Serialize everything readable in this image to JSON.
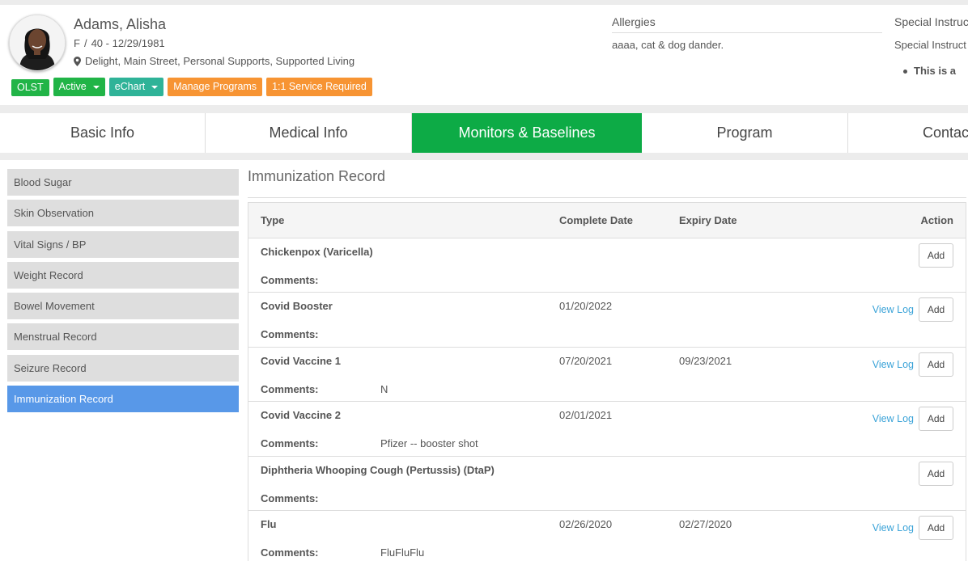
{
  "patient": {
    "name": "Adams, Alisha",
    "gender": "F",
    "age_dob": "40 - 12/29/1981",
    "address": "Delight, Main Street, Personal Supports, Supported Living"
  },
  "badges": {
    "olst": "OLST",
    "active": "Active",
    "echart": "eChart",
    "manage_programs": "Manage Programs",
    "service_required": "1:1 Service Required"
  },
  "allergies": {
    "title": "Allergies",
    "text": "aaaa, cat & dog dander."
  },
  "special": {
    "title": "Special Instruc",
    "subtitle": "Special Instruct",
    "bullet": "This is a"
  },
  "tabs": [
    {
      "label": "Basic Info"
    },
    {
      "label": "Medical Info"
    },
    {
      "label": "Monitors & Baselines"
    },
    {
      "label": "Program"
    },
    {
      "label": "Contac"
    }
  ],
  "sidebar": {
    "items": [
      {
        "label": "Blood Sugar"
      },
      {
        "label": "Skin Observation"
      },
      {
        "label": "Vital Signs / BP"
      },
      {
        "label": "Weight Record"
      },
      {
        "label": "Bowel Movement"
      },
      {
        "label": "Menstrual Record"
      },
      {
        "label": "Seizure Record"
      },
      {
        "label": "Immunization Record"
      }
    ]
  },
  "main": {
    "title": "Immunization Record",
    "headers": {
      "type": "Type",
      "complete_date": "Complete Date",
      "expiry_date": "Expiry Date",
      "action": "Action"
    },
    "comments_label": "Comments:",
    "view_log_label": "View Log",
    "add_label": "Add",
    "rows": [
      {
        "type": "Chickenpox (Varicella)",
        "complete_date": "",
        "expiry_date": "",
        "comment": ""
      },
      {
        "type": "Covid Booster",
        "complete_date": "01/20/2022",
        "expiry_date": "",
        "comment": ""
      },
      {
        "type": "Covid Vaccine 1",
        "complete_date": "07/20/2021",
        "expiry_date": "09/23/2021",
        "comment": "N"
      },
      {
        "type": "Covid Vaccine 2",
        "complete_date": "02/01/2021",
        "expiry_date": "",
        "comment": "Pfizer -- booster shot"
      },
      {
        "type": "Diphtheria Whooping Cough (Pertussis) (DtaP)",
        "complete_date": "",
        "expiry_date": "",
        "comment": ""
      },
      {
        "type": "Flu",
        "complete_date": "02/26/2020",
        "expiry_date": "02/27/2020",
        "comment": "FluFluFlu"
      }
    ]
  },
  "colors": {
    "accent_green": "#0dab46",
    "badge_green": "#21b447",
    "badge_teal": "#2fb398",
    "badge_orange": "#f79433",
    "sidebar_active": "#5898e8",
    "link_blue": "#3ba3d8"
  },
  "icons": {
    "avatar": "patient-photo",
    "location": "map-marker-icon",
    "dropdown": "caret-down-icon"
  }
}
